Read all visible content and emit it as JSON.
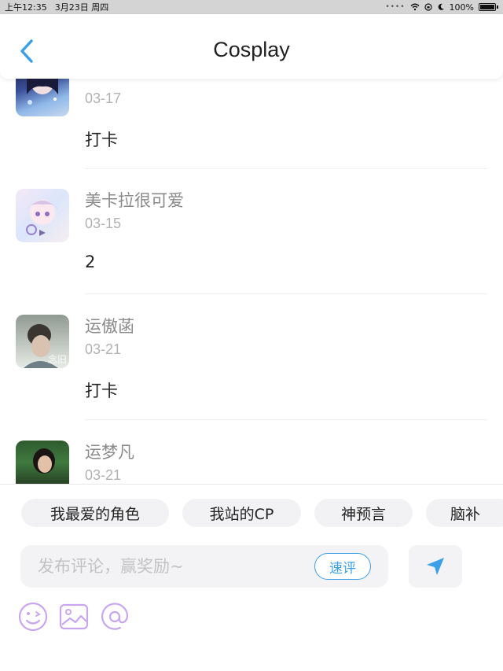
{
  "status_bar": {
    "time": "上午12:35",
    "date": "3月23日 周四",
    "battery": "100%"
  },
  "nav": {
    "title": "Cosplay"
  },
  "posts": [
    {
      "name": "",
      "date": "03-17",
      "content": "打卡"
    },
    {
      "name": "美卡拉很可爱",
      "date": "03-15",
      "content": "2"
    },
    {
      "name": "运傲菡",
      "date": "03-21",
      "content": "打卡"
    },
    {
      "name": "运梦凡",
      "date": "03-21",
      "content": ""
    }
  ],
  "avatar_marks": {
    "third": "念旧"
  },
  "chips": [
    "我最爱的角色",
    "我站的CP",
    "神预言",
    "脑补"
  ],
  "composer": {
    "placeholder": "发布评论，赢奖励~",
    "quick_review": "速评"
  },
  "colors": {
    "accent": "#3aa0e8",
    "tool_icon": "#c9a6f0"
  },
  "icons": {
    "back": "chevron-left-icon",
    "send": "send-arrow-icon",
    "emoji": "emoji-icon",
    "image": "image-icon",
    "mention": "at-icon"
  }
}
